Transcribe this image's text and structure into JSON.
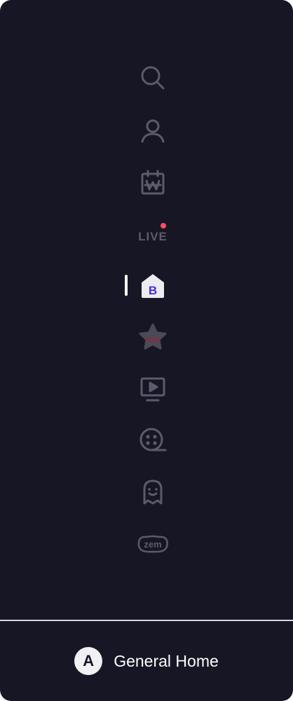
{
  "sidebar": {
    "items": [
      {
        "id": "search",
        "icon": "search-icon"
      },
      {
        "id": "profile",
        "icon": "user-icon"
      },
      {
        "id": "calendar",
        "icon": "calendar-won-icon"
      },
      {
        "id": "live",
        "icon": "live-icon",
        "label": "LIVE",
        "has_notification": true
      },
      {
        "id": "home",
        "icon": "home-b-icon",
        "active": true
      },
      {
        "id": "new",
        "icon": "star-new-icon",
        "label": "NEW"
      },
      {
        "id": "video",
        "icon": "tv-play-icon"
      },
      {
        "id": "reel",
        "icon": "film-reel-icon"
      },
      {
        "id": "ghost",
        "icon": "ghost-icon"
      },
      {
        "id": "zem",
        "icon": "zem-logo-icon",
        "label": "zem"
      }
    ]
  },
  "footer": {
    "badge": "A",
    "label": "General Home"
  },
  "colors": {
    "background": "#161624",
    "icon": "#5b5b6b",
    "active_icon_bg": "#ebebf0",
    "active_accent": "#4a2bd6",
    "notification": "#ff4d5e",
    "new_text": "#8a2a3a"
  }
}
